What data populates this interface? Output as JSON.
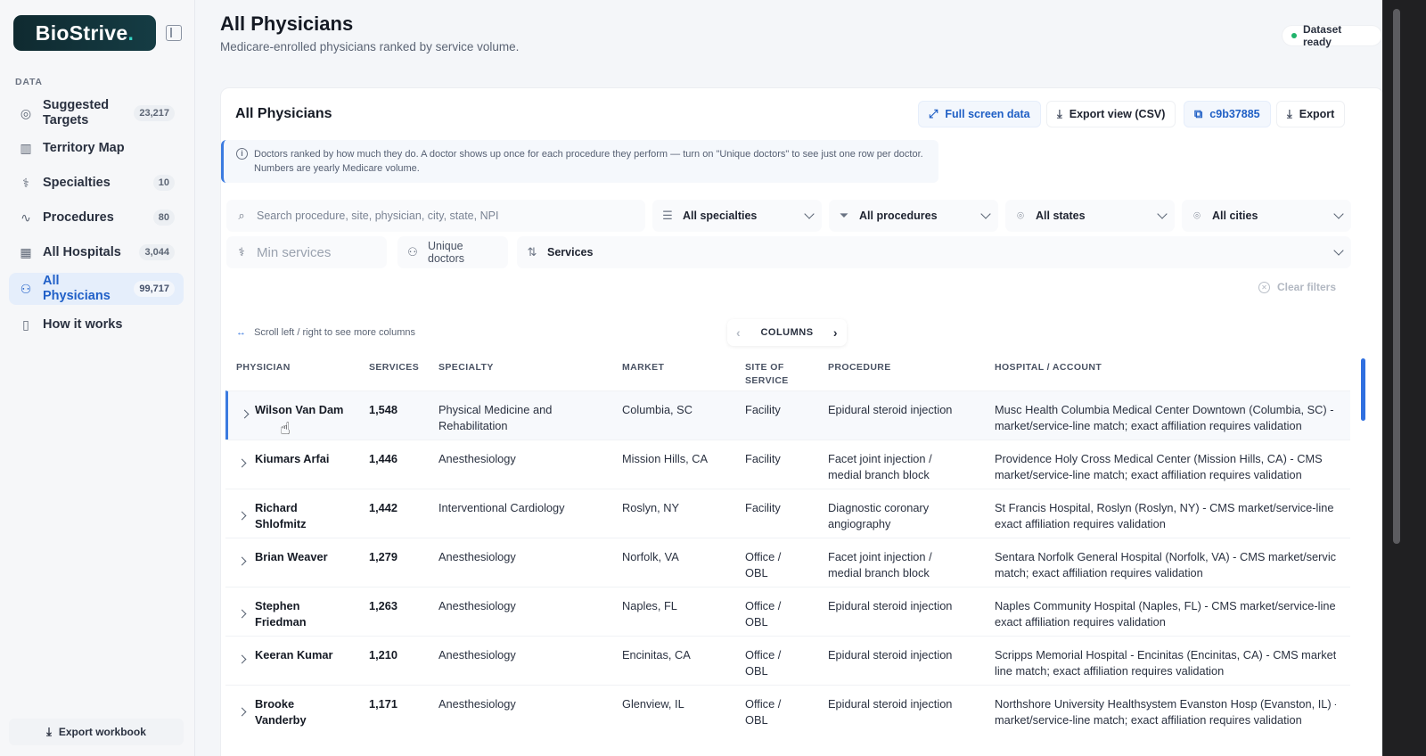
{
  "app": {
    "logo_text": "BioStrive",
    "logo_dot": "."
  },
  "sidebar": {
    "section": "DATA",
    "items": [
      {
        "label": "Suggested Targets",
        "count": "23,217",
        "icon": "target-icon"
      },
      {
        "label": "Territory Map",
        "count": "",
        "icon": "map-icon"
      },
      {
        "label": "Specialties",
        "count": "10",
        "icon": "stethoscope-icon"
      },
      {
        "label": "Procedures",
        "count": "80",
        "icon": "pulse-icon"
      },
      {
        "label": "All Hospitals",
        "count": "3,044",
        "icon": "building-icon"
      },
      {
        "label": "All Physicians",
        "count": "99,717",
        "icon": "users-icon"
      },
      {
        "label": "How it works",
        "count": "",
        "icon": "book-icon"
      }
    ],
    "export_workbook": "Export workbook"
  },
  "header": {
    "title": "All Physicians",
    "subtitle": "Medicare-enrolled physicians ranked by service volume.",
    "status": "Dataset ready",
    "status_color": "#20b36b"
  },
  "card": {
    "title": "All Physicians",
    "buttons": {
      "fullscreen": "Full screen data",
      "export_csv": "Export view (CSV)",
      "hash": "c9b37885",
      "export": "Export"
    },
    "info": "Doctors ranked by how much they do. A doctor shows up once for each procedure they perform — turn on \"Unique doctors\" to see just one row per doctor. Numbers are yearly Medicare volume."
  },
  "filters": {
    "search_placeholder": "Search procedure, site, physician, city, state, NPI",
    "specialties": "All specialties",
    "procedures": "All procedures",
    "states": "All states",
    "cities": "All cities",
    "min_services_placeholder": "Min services",
    "unique_doctors": "Unique doctors",
    "sort": "Services",
    "clear": "Clear filters"
  },
  "table": {
    "scroll_hint": "Scroll left / right to see more columns",
    "columns_label": "COLUMNS",
    "headers": {
      "physician": "PHYSICIAN",
      "services": "SERVICES",
      "specialty": "SPECIALTY",
      "market": "MARKET",
      "site_a": "SITE OF",
      "site_b": "SERVICE",
      "procedure": "PROCEDURE",
      "hospital": "HOSPITAL / ACCOUNT"
    },
    "rows": [
      {
        "name_a": "Wilson Van Dam",
        "name_b": "",
        "services": "1,548",
        "spec_a": "Physical Medicine and",
        "spec_b": "Rehabilitation",
        "market": "Columbia, SC",
        "site_a": "Facility",
        "site_b": "",
        "proc_a": "Epidural steroid injection",
        "proc_b": "",
        "hosp_a": "Musc Health Columbia Medical Center Downtown (Columbia, SC) - CMS",
        "hosp_b": "market/service-line match; exact affiliation requires validation"
      },
      {
        "name_a": "Kiumars Arfai",
        "name_b": "",
        "services": "1,446",
        "spec_a": "Anesthesiology",
        "spec_b": "",
        "market": "Mission Hills, CA",
        "site_a": "Facility",
        "site_b": "",
        "proc_a": "Facet joint injection /",
        "proc_b": "medial branch block",
        "hosp_a": "Providence Holy Cross Medical Center (Mission Hills, CA) - CMS",
        "hosp_b": "market/service-line match; exact affiliation requires validation"
      },
      {
        "name_a": "Richard",
        "name_b": "Shlofmitz",
        "services": "1,442",
        "spec_a": "Interventional Cardiology",
        "spec_b": "",
        "market": "Roslyn, NY",
        "site_a": "Facility",
        "site_b": "",
        "proc_a": "Diagnostic coronary",
        "proc_b": "angiography",
        "hosp_a": "St Francis Hospital, Roslyn (Roslyn, NY) - CMS market/service-line match;",
        "hosp_b": "exact affiliation requires validation"
      },
      {
        "name_a": "Brian Weaver",
        "name_b": "",
        "services": "1,279",
        "spec_a": "Anesthesiology",
        "spec_b": "",
        "market": "Norfolk, VA",
        "site_a": "Office /",
        "site_b": "OBL",
        "proc_a": "Facet joint injection /",
        "proc_b": "medial branch block",
        "hosp_a": "Sentara Norfolk General Hospital (Norfolk, VA) - CMS market/service-line",
        "hosp_b": "match; exact affiliation requires validation"
      },
      {
        "name_a": "Stephen",
        "name_b": "Friedman",
        "services": "1,263",
        "spec_a": "Anesthesiology",
        "spec_b": "",
        "market": "Naples, FL",
        "site_a": "Office /",
        "site_b": "OBL",
        "proc_a": "Epidural steroid injection",
        "proc_b": "",
        "hosp_a": "Naples Community Hospital (Naples, FL) - CMS market/service-line match;",
        "hosp_b": "exact affiliation requires validation"
      },
      {
        "name_a": "Keeran Kumar",
        "name_b": "",
        "services": "1,210",
        "spec_a": "Anesthesiology",
        "spec_b": "",
        "market": "Encinitas, CA",
        "site_a": "Office /",
        "site_b": "OBL",
        "proc_a": "Epidural steroid injection",
        "proc_b": "",
        "hosp_a": "Scripps Memorial Hospital - Encinitas (Encinitas, CA) - CMS market/service-",
        "hosp_b": "line match; exact affiliation requires validation"
      },
      {
        "name_a": "Brooke",
        "name_b": "Vanderby",
        "services": "1,171",
        "spec_a": "Anesthesiology",
        "spec_b": "",
        "market": "Glenview, IL",
        "site_a": "Office /",
        "site_b": "OBL",
        "proc_a": "Epidural steroid injection",
        "proc_b": "",
        "hosp_a": "Northshore University Healthsystem Evanston Hosp (Evanston, IL) - CMS",
        "hosp_b": "market/service-line match; exact affiliation requires validation"
      }
    ]
  }
}
